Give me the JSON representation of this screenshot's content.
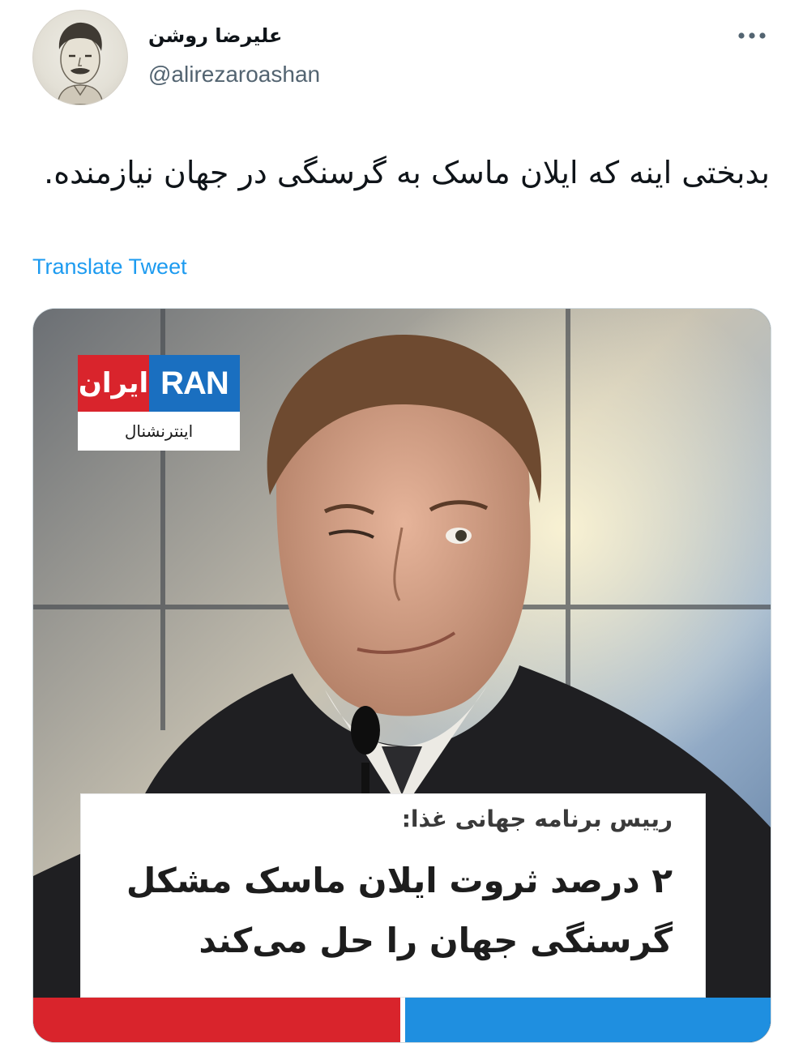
{
  "tweet": {
    "display_name": "علیرضا روشن",
    "handle": "@alirezaroashan",
    "text": "بدبختی اینه که ایلان ماسک به گرسنگی در جهان نیازمنده.",
    "translate_label": "Translate Tweet",
    "more_icon": "more-horizontal-icon"
  },
  "media": {
    "logo": {
      "persian_word": "ایران",
      "latin_word": "RAN",
      "subtitle": "اینترنشنال",
      "colors": {
        "red": "#d9242c",
        "blue": "#1a6fc0"
      }
    },
    "caption": {
      "kicker": "رییس برنامه جهانی غذا:",
      "headline": "۲ درصد ثروت ایلان ماسک مشکل گرسنگی جهان را حل می‌کند"
    },
    "bottom_bar_colors": {
      "left": "#d9242c",
      "right": "#1f8fe0"
    }
  },
  "colors": {
    "text": "#0f1419",
    "secondary": "#536471",
    "link": "#1d9bf0"
  }
}
